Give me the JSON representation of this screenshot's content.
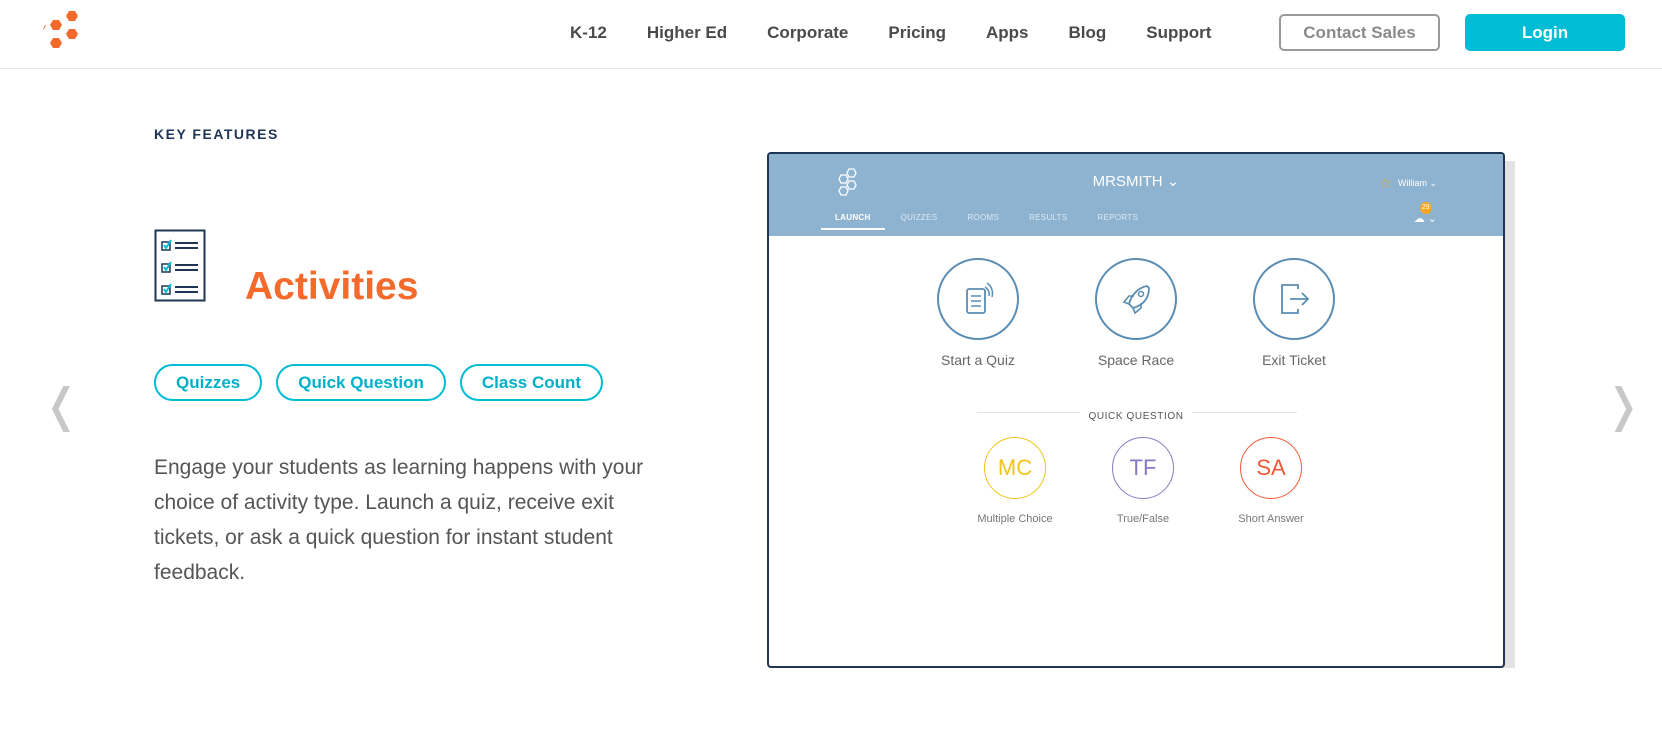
{
  "header": {
    "nav": [
      "K-12",
      "Higher Ed",
      "Corporate",
      "Pricing",
      "Apps",
      "Blog",
      "Support"
    ],
    "contact_label": "Contact Sales",
    "login_label": "Login"
  },
  "feature": {
    "kicker": "KEY FEATURES",
    "title": "Activities",
    "pills": [
      "Quizzes",
      "Quick Question",
      "Class Count"
    ],
    "description": "Engage your students as learning happens with your choice of activity type. Launch a quiz, receive exit tickets, or ask a quick question for instant student feedback."
  },
  "carousel": {
    "prev": "❬",
    "next": "❭"
  },
  "app": {
    "room": "MRSMITH",
    "user": "William",
    "tabs": [
      "LAUNCH",
      "QUIZZES",
      "ROOMS",
      "RESULTS",
      "REPORTS"
    ],
    "notification_count": "29",
    "launch": [
      {
        "label": "Start a Quiz"
      },
      {
        "label": "Space Race"
      },
      {
        "label": "Exit Ticket"
      }
    ],
    "quick_question_title": "QUICK QUESTION",
    "quick": [
      {
        "abbr": "MC",
        "label": "Multiple Choice",
        "color": "#f2c318"
      },
      {
        "abbr": "TF",
        "label": "True/False",
        "color": "#8a78c4"
      },
      {
        "abbr": "SA",
        "label": "Short Answer",
        "color": "#ef5a35"
      }
    ]
  },
  "colors": {
    "accent": "#00bcd4",
    "brand": "#f46a2c",
    "navy": "#1f3556"
  }
}
